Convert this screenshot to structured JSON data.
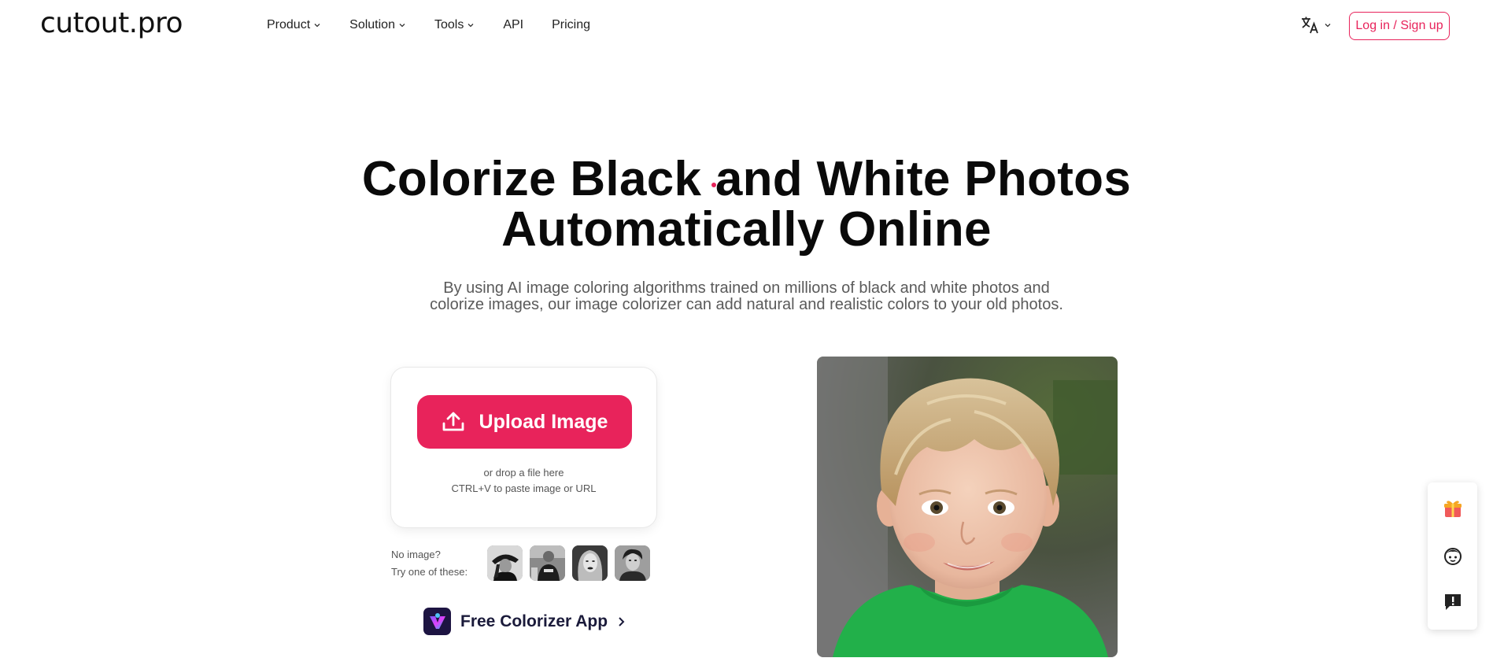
{
  "header": {
    "logo": "cutout.pro",
    "nav": [
      {
        "label": "Product",
        "dropdown": true
      },
      {
        "label": "Solution",
        "dropdown": true
      },
      {
        "label": "Tools",
        "dropdown": true
      },
      {
        "label": "API",
        "dropdown": false
      },
      {
        "label": "Pricing",
        "dropdown": false
      }
    ],
    "language_icon": "translate-icon",
    "login_label": "Log in / Sign up"
  },
  "hero": {
    "title_line1": "Colorize Black and White Photos",
    "title_line2": "Automatically Online",
    "subtitle_line1": "By using AI image coloring algorithms trained on millions of black and white photos and",
    "subtitle_line2": "colorize images, our image colorizer can add natural and realistic colors to your old photos."
  },
  "upload": {
    "button_label": "Upload Image",
    "drop_hint": "or drop a file here",
    "paste_hint": "CTRL+V to paste image or URL"
  },
  "samples": {
    "label_line1": "No image?",
    "label_line2": "Try one of these:",
    "count": 4
  },
  "app_link": {
    "label": "Free Colorizer App"
  },
  "floating": {
    "buttons": [
      "gift-icon",
      "support-avatar-icon",
      "feedback-icon"
    ]
  },
  "colors": {
    "accent": "#e8235b",
    "text": "#0a0a0a",
    "muted": "#5a5a5a"
  }
}
